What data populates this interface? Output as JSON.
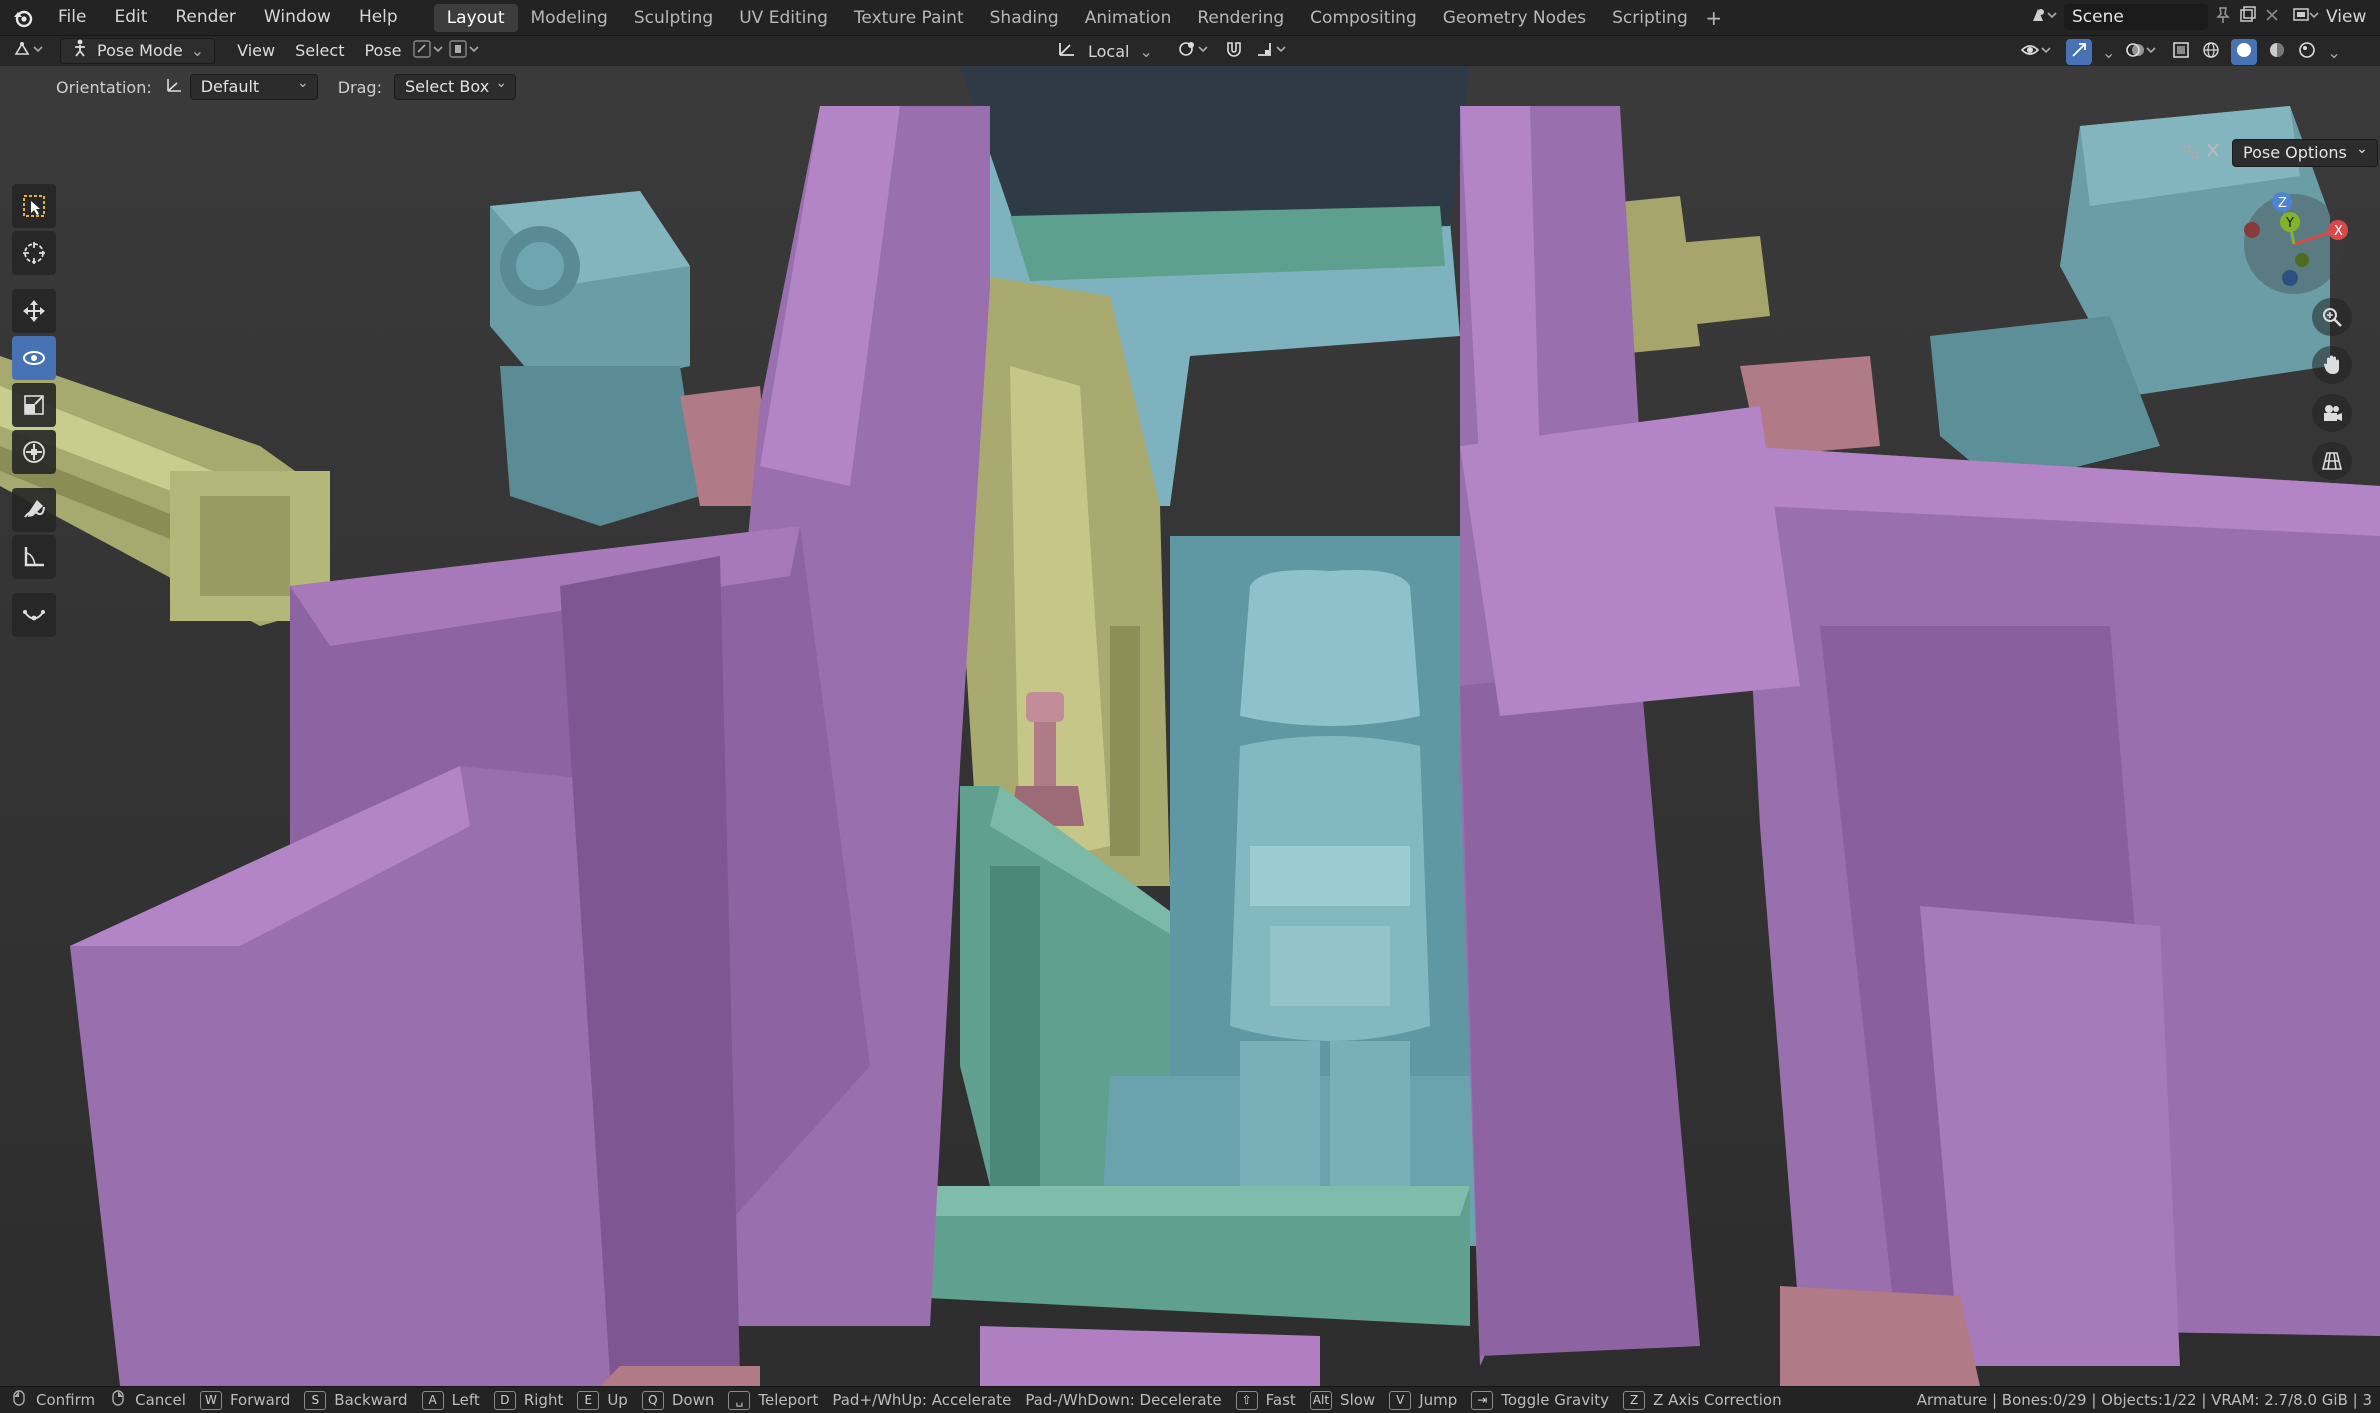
{
  "app": {
    "logo_icon": "blender-logo-icon"
  },
  "menu": [
    "File",
    "Edit",
    "Render",
    "Window",
    "Help"
  ],
  "workspaces": {
    "tabs": [
      "Layout",
      "Modeling",
      "Sculpting",
      "UV Editing",
      "Texture Paint",
      "Shading",
      "Animation",
      "Rendering",
      "Compositing",
      "Geometry Nodes",
      "Scripting"
    ],
    "active": "Layout",
    "add_label": "+"
  },
  "scene": {
    "name": "Scene",
    "view_layer_label": "View"
  },
  "header": {
    "mode": "Pose Mode",
    "menus": [
      "View",
      "Select",
      "Pose"
    ],
    "transform_orientation": "Local"
  },
  "tool_settings": {
    "orientation_label": "Orientation:",
    "orientation_value": "Default",
    "drag_label": "Drag:",
    "drag_value": "Select Box",
    "pose_options": "Pose Options"
  },
  "gizmo": {
    "x": "X",
    "y": "Y",
    "z": "Z"
  },
  "colors": {
    "purple": "#9a6fae",
    "teal": "#6ba2ad",
    "green": "#5fa08e",
    "olive": "#a5a56c",
    "pink": "#b07a86",
    "accent": "#4772b3"
  },
  "status": {
    "hints": [
      {
        "key": "⎋",
        "label": "Confirm"
      },
      {
        "key": "⎋",
        "label": "Cancel"
      },
      {
        "key": "W",
        "label": "Forward"
      },
      {
        "key": "S",
        "label": "Backward"
      },
      {
        "key": "A",
        "label": "Left"
      },
      {
        "key": "D",
        "label": "Right"
      },
      {
        "key": "E",
        "label": "Up"
      },
      {
        "key": "Q",
        "label": "Down"
      },
      {
        "key": "␣",
        "label": "Teleport"
      },
      {
        "key": "",
        "label": "Pad+/WhUp: Accelerate"
      },
      {
        "key": "",
        "label": "Pad-/WhDown: Decelerate"
      },
      {
        "key": "⇧",
        "label": "Fast"
      },
      {
        "key": "Alt",
        "label": "Slow"
      },
      {
        "key": "V",
        "label": "Jump"
      },
      {
        "key": "⇥",
        "label": "Toggle Gravity"
      },
      {
        "key": "Z",
        "label": "Z Axis Correction"
      }
    ],
    "info": "Armature | Bones:0/29 | Objects:1/22 | VRAM: 2.7/8.0 GiB | 3"
  }
}
